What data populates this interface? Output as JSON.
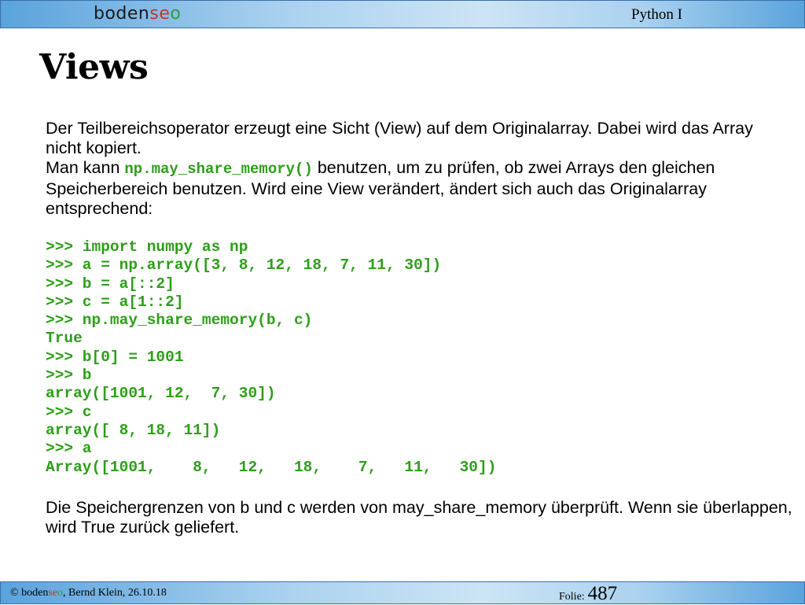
{
  "header": {
    "logo": {
      "part1": "boden",
      "part2": "se",
      "part3": "o"
    },
    "course": "Python I"
  },
  "title": "Views",
  "intro": {
    "p1": "Der Teilbereichsoperator erzeugt eine Sicht (View)  auf dem Originalarray. Dabei wird das Array nicht kopiert.",
    "p2_before": "Man kann ",
    "p2_code": "np.may_share_memory()",
    "p2_after": " benutzen, um zu prüfen, ob zwei Arrays den gleichen Speicherbereich benutzen. Wird eine View verändert, ändert sich auch das Originalarray entsprechend:"
  },
  "code_lines": [
    ">>> import numpy as np",
    ">>> a = np.array([3, 8, 12, 18, 7, 11, 30])",
    ">>> b = a[::2]",
    ">>> c = a[1::2]",
    ">>> np.may_share_memory(b, c)",
    "True",
    ">>> b[0] = 1001",
    ">>> b",
    "array([1001, 12,  7, 30])",
    ">>> c",
    "array([ 8, 18, 11])",
    ">>> a",
    "Array([1001,    8,   12,   18,    7,   11,   30])"
  ],
  "closing": "Die Speichergrenzen von b und c werden von may_share_memory überprüft. Wenn sie überlappen, wird True zurück geliefert.",
  "footer": {
    "copyright": "© ",
    "logo": {
      "part1": "boden",
      "part2": "se",
      "part3": "o"
    },
    "author_date": ", Bernd Klein, 26.10.18",
    "folio_label": "Folie:",
    "folio_number": "487"
  }
}
